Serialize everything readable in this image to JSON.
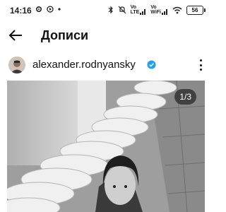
{
  "status_bar": {
    "time": "14:16",
    "signal_label_1": "Vo",
    "signal_label_2": "LTE",
    "signal_label_3": "Vo",
    "signal_label_4": "WiFi",
    "battery": "56"
  },
  "header": {
    "title": "Дописи"
  },
  "post": {
    "author": "alexander.rodnyansky",
    "verified_color": "#1da1f2",
    "image_counter": "1/3"
  },
  "icons": [
    "gear-icon",
    "media-icon",
    "dot-icon",
    "bluetooth-icon",
    "mute-icon",
    "signal-icon",
    "wifi-icon",
    "battery-icon",
    "back-arrow-icon",
    "verified-badge-icon",
    "more-vertical-icon"
  ]
}
